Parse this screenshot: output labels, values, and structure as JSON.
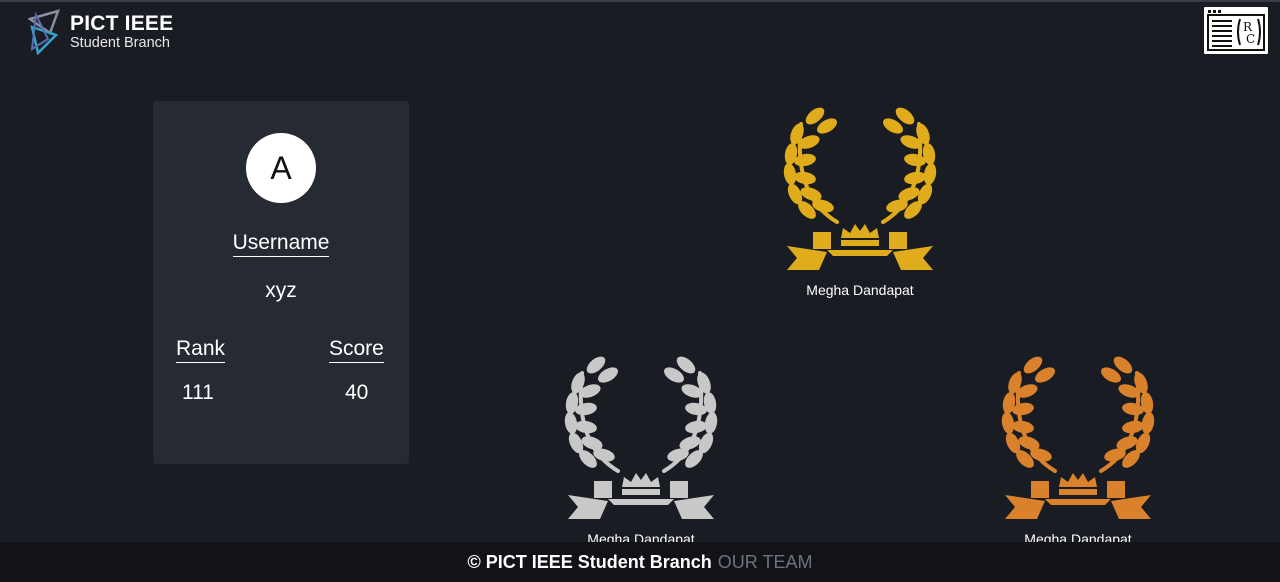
{
  "header": {
    "brand_title": "PICT IEEE",
    "brand_subtitle": "Student Branch",
    "brand_icon": "pict-ieee-logo-icon",
    "right_icon": "rc-logo-icon"
  },
  "profile": {
    "avatar_letter": "A",
    "username_label": "Username",
    "username_value": "xyz",
    "rank_label": "Rank",
    "rank_value": "111",
    "score_label": "Score",
    "score_value": "40"
  },
  "leaderboard": {
    "first": {
      "name": "Megha Dandapat",
      "color": "#e0ac1c",
      "icon": "laurel-crown-icon"
    },
    "second": {
      "name": "Megha Dandapat",
      "color": "#c8c8c8",
      "icon": "laurel-crown-icon"
    },
    "third": {
      "name": "Megha Dandapat",
      "color": "#d9822b",
      "icon": "laurel-crown-icon"
    }
  },
  "footer": {
    "copyright": "© PICT IEEE Student Branch",
    "team_link": "OUR TEAM"
  },
  "colors": {
    "background": "#1a1c23",
    "card": "#252a33",
    "footer": "#121317",
    "muted_link": "#6b7280"
  }
}
